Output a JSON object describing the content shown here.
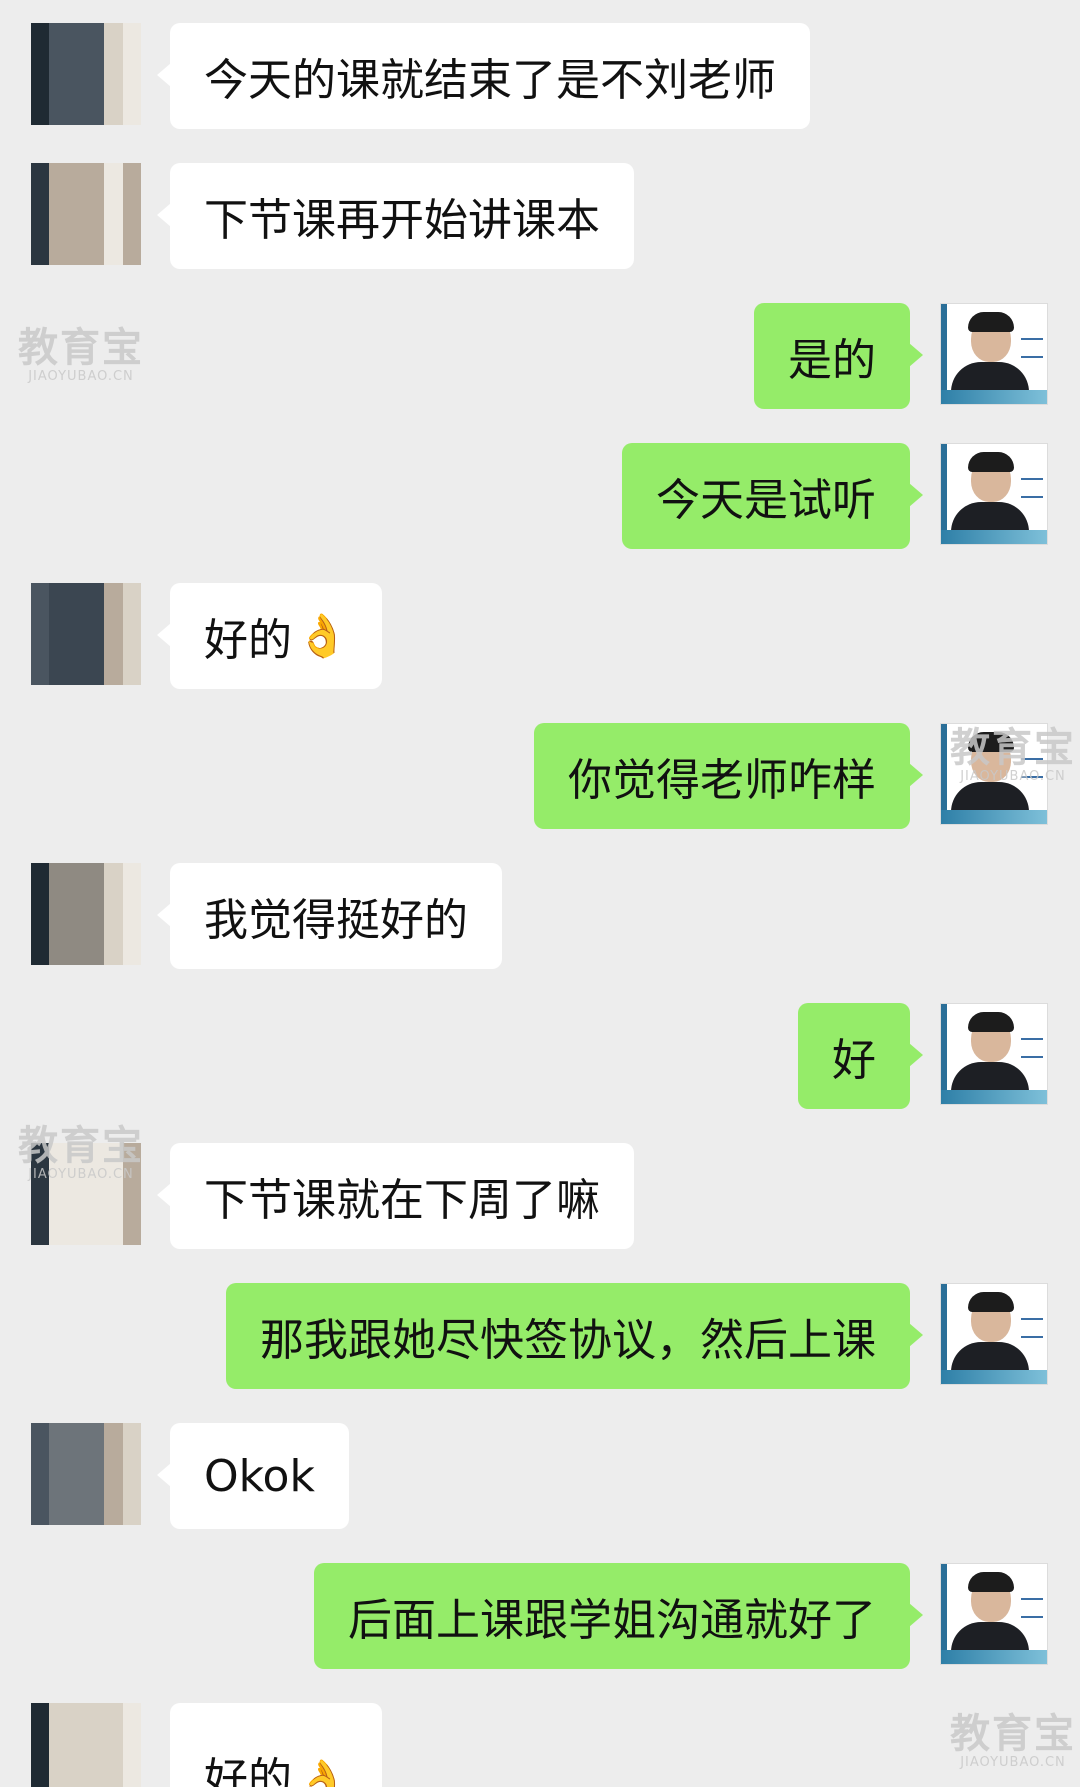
{
  "watermark": {
    "main": "教育宝",
    "sub": "JIAOYUBAO.CN"
  },
  "colors": {
    "background": "#ededed",
    "sent_bubble": "#95ec69",
    "received_bubble": "#ffffff"
  },
  "messages": [
    {
      "side": "left",
      "text": "今天的课就结束了是不刘老师"
    },
    {
      "side": "left",
      "text": "下节课再开始讲课本"
    },
    {
      "side": "right",
      "text": "是的"
    },
    {
      "side": "right",
      "text": "今天是试听"
    },
    {
      "side": "left",
      "text": "好的",
      "emoji": "👌"
    },
    {
      "side": "right",
      "text": "你觉得老师咋样"
    },
    {
      "side": "left",
      "text": "我觉得挺好的"
    },
    {
      "side": "right",
      "text": "好"
    },
    {
      "side": "left",
      "text": "下节课就在下周了嘛"
    },
    {
      "side": "right",
      "text": "那我跟她尽快签协议，然后上课"
    },
    {
      "side": "left",
      "text": "Okok"
    },
    {
      "side": "right",
      "text": "后面上课跟学姐沟通就好了"
    },
    {
      "side": "left",
      "text": "好的",
      "emoji": "👌"
    }
  ]
}
